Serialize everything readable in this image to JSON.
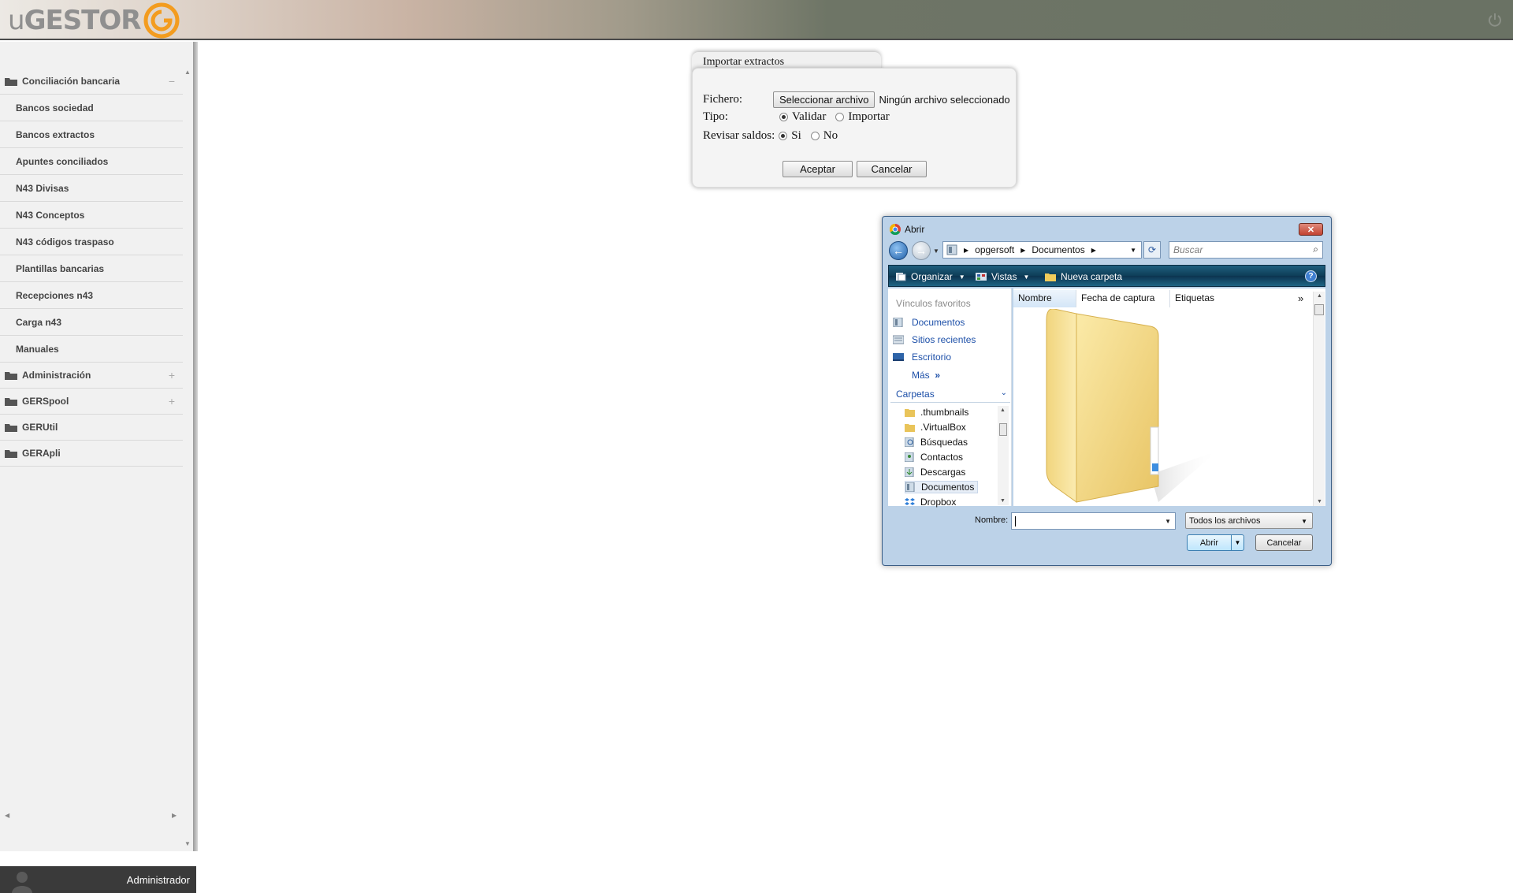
{
  "header": {
    "logo_prefix": "u",
    "logo_main": "GESTOR",
    "brand_color": "#f39c1f",
    "power_icon": "power-icon"
  },
  "sidebar": {
    "groups": [
      {
        "label": "Conciliación bancaria",
        "toggle": "−",
        "items": [
          "Bancos sociedad",
          "Bancos extractos",
          "Apuntes conciliados",
          "N43 Divisas",
          "N43 Conceptos",
          "N43 códigos traspaso",
          "Plantillas bancarias",
          "Recepciones n43",
          "Carga n43",
          "Manuales"
        ]
      },
      {
        "label": "Administración",
        "toggle": "+"
      },
      {
        "label": "GERSpool",
        "toggle": "+"
      },
      {
        "label": "GERUtil"
      },
      {
        "label": "GERApli"
      }
    ],
    "user": "Administrador"
  },
  "import_dialog": {
    "title": "Importar extractos",
    "fichero_label": "Fichero:",
    "select_file_button": "Seleccionar archivo",
    "no_file_text": "Ningún archivo seleccionado",
    "tipo_label": "Tipo:",
    "tipo_options": [
      {
        "label": "Validar",
        "checked": true
      },
      {
        "label": "Importar",
        "checked": false
      }
    ],
    "revisar_label": "Revisar saldos:",
    "revisar_options": [
      {
        "label": "Si",
        "checked": true
      },
      {
        "label": "No",
        "checked": false
      }
    ],
    "accept_button": "Aceptar",
    "cancel_button": "Cancelar"
  },
  "open_dialog": {
    "title": "Abrir",
    "path": [
      "opgersoft",
      "Documentos"
    ],
    "search_placeholder": "Buscar",
    "toolbar": {
      "organize": "Organizar",
      "views": "Vistas",
      "new_folder": "Nueva carpeta"
    },
    "favorites_header": "Vínculos favoritos",
    "favorites": [
      "Documentos",
      "Sitios recientes",
      "Escritorio"
    ],
    "more_label": "Más",
    "more_arrows": "»",
    "folders_header": "Carpetas",
    "folders": [
      ".thumbnails",
      ".VirtualBox",
      "Búsquedas",
      "Contactos",
      "Descargas",
      "Documentos",
      "Dropbox"
    ],
    "selected_folder": "Documentos",
    "columns": [
      "Nombre",
      "Fecha de captura",
      "Etiquetas"
    ],
    "more_columns": "»",
    "filename_label": "Nombre:",
    "filename_value": "",
    "filetype": "Todos los archivos",
    "open_button": "Abrir",
    "cancel_button": "Cancelar"
  }
}
